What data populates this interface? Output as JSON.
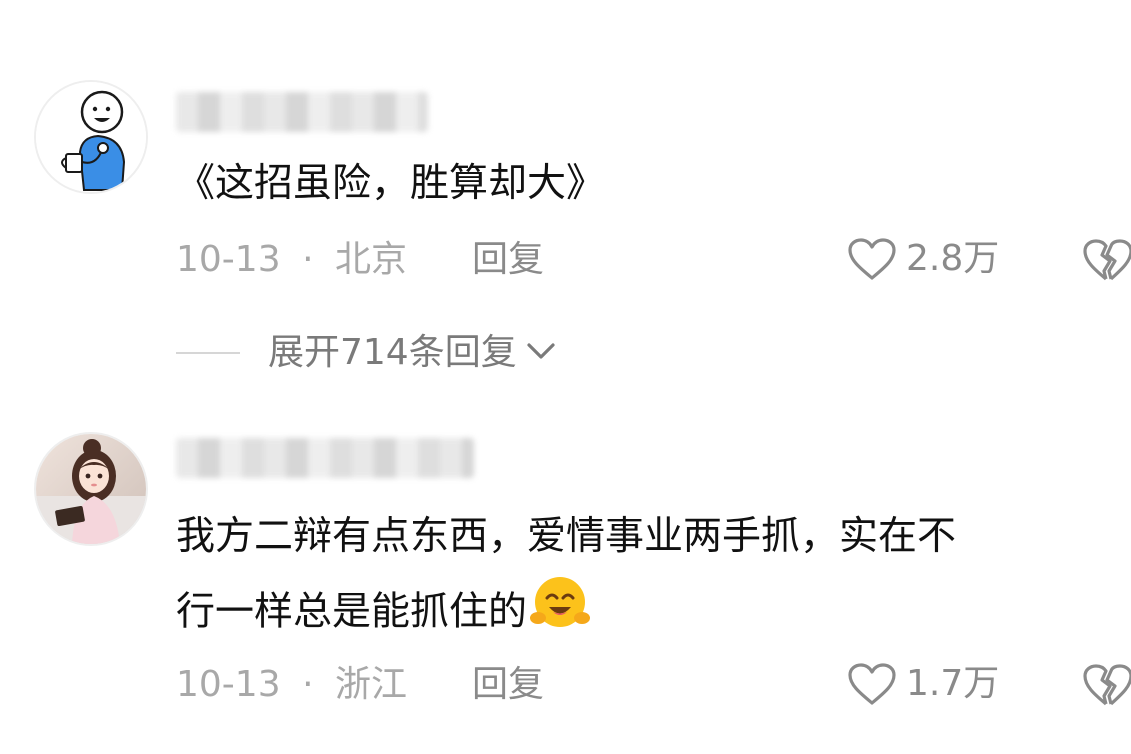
{
  "comments": [
    {
      "text": "《这招虽险，胜算却大》",
      "date": "10-13",
      "separator": "·",
      "location": "北京",
      "reply_label": "回复",
      "like_count": "2.8万",
      "expand_label": "展开714条回复"
    },
    {
      "text_line1": "我方二辩有点东西，爱情事业两手抓，实在不",
      "text_line2": "行一样总是能抓住的",
      "date": "10-13",
      "separator": "·",
      "location": "浙江",
      "reply_label": "回复",
      "like_count": "1.7万"
    }
  ],
  "icons": {
    "like": "heart-outline-icon",
    "dislike": "broken-heart-icon",
    "expand": "chevron-down-icon",
    "emoji": "smiling-hug-emoji"
  },
  "colors": {
    "text": "#111111",
    "meta": "#a8a8a8",
    "secondary": "#8a8a8a",
    "avatar1_shirt": "#3a8ee6"
  }
}
